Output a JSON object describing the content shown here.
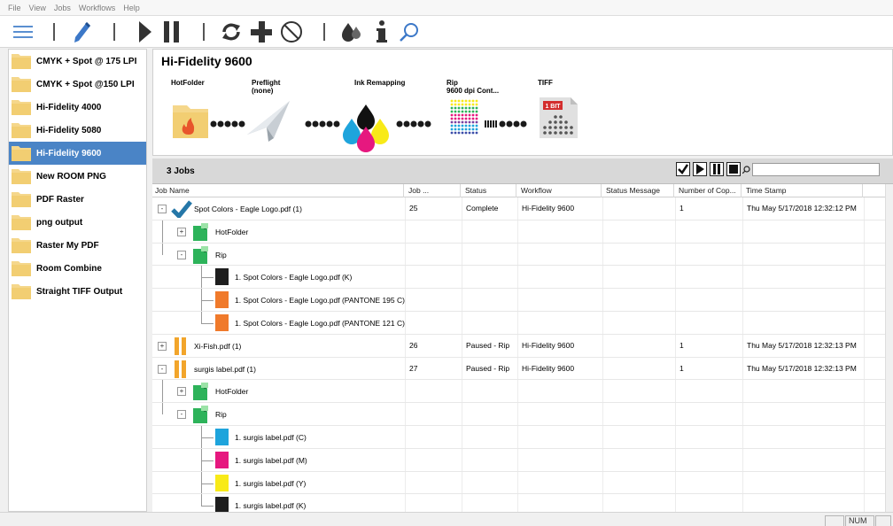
{
  "menu": [
    "File",
    "View",
    "Jobs",
    "Workflows",
    "Help"
  ],
  "workflows": [
    {
      "label": "CMYK + Spot @ 175 LPI",
      "selected": false
    },
    {
      "label": "CMYK + Spot @150 LPI",
      "selected": false
    },
    {
      "label": "Hi-Fidelity 4000",
      "selected": false
    },
    {
      "label": "Hi-Fidelity 5080",
      "selected": false
    },
    {
      "label": "Hi-Fidelity 9600",
      "selected": true
    },
    {
      "label": "New ROOM PNG",
      "selected": false
    },
    {
      "label": "PDF Raster",
      "selected": false
    },
    {
      "label": "png output",
      "selected": false
    },
    {
      "label": "Raster My PDF",
      "selected": false
    },
    {
      "label": "Room Combine",
      "selected": false
    },
    {
      "label": "Straight TIFF Output",
      "selected": false
    }
  ],
  "pipeline": {
    "title": "Hi-Fidelity 9600",
    "stages": [
      {
        "name": "HotFolder",
        "sub": "",
        "icon": "hotfolder-icon"
      },
      {
        "name": "Preflight",
        "sub": "(none)",
        "icon": "paper-plane-icon"
      },
      {
        "name": "Ink Remapping",
        "sub": "",
        "icon": "ink-drops-icon"
      },
      {
        "name": "Rip",
        "sub": "9600 dpi Cont...",
        "icon": "halftone-grid-icon"
      },
      {
        "name": "TIFF",
        "sub": "",
        "icon": "tiff-file-icon"
      }
    ],
    "tiff_badge": "1 BIT"
  },
  "jobs_bar": {
    "count_label": "3 Jobs",
    "search_value": ""
  },
  "columns": [
    "Job Name",
    "Job ...",
    "Status",
    "Workflow",
    "Status Message",
    "Number of Cop...",
    "Time Stamp"
  ],
  "rows": [
    {
      "level": 0,
      "expander": "-",
      "icon": "check",
      "name": "Spot Colors - Eagle Logo.pdf (1)",
      "job": "25",
      "status": "Complete",
      "workflow": "Hi-Fidelity 9600",
      "message": "",
      "copies": "1",
      "time": "Thu May 5/17/2018 12:32:12 PM"
    },
    {
      "level": 1,
      "expander": "+",
      "icon": "step",
      "name": "HotFolder"
    },
    {
      "level": 1,
      "expander": "-",
      "icon": "step",
      "name": "Rip"
    },
    {
      "level": 2,
      "color": "#1e1e1e",
      "name": "1. Spot Colors - Eagle Logo.pdf (K)"
    },
    {
      "level": 2,
      "color": "#f07a2b",
      "name": "1. Spot Colors - Eagle Logo.pdf (PANTONE 195 C)"
    },
    {
      "level": 2,
      "color": "#f07a2b",
      "name": "1. Spot Colors - Eagle Logo.pdf (PANTONE 121 C)"
    },
    {
      "level": 0,
      "expander": "+",
      "icon": "pause",
      "name": "Xi-Fish.pdf (1)",
      "job": "26",
      "status": "Paused - Rip",
      "workflow": "Hi-Fidelity 9600",
      "message": "",
      "copies": "1",
      "time": "Thu May 5/17/2018 12:32:13 PM"
    },
    {
      "level": 0,
      "expander": "-",
      "icon": "pause",
      "name": "surgis label.pdf (1)",
      "job": "27",
      "status": "Paused - Rip",
      "workflow": "Hi-Fidelity 9600",
      "message": "",
      "copies": "1",
      "time": "Thu May 5/17/2018 12:32:13 PM"
    },
    {
      "level": 1,
      "expander": "+",
      "icon": "step",
      "name": "HotFolder"
    },
    {
      "level": 1,
      "expander": "-",
      "icon": "step",
      "name": "Rip"
    },
    {
      "level": 2,
      "color": "#1ea4dc",
      "name": "1. surgis label.pdf (C)"
    },
    {
      "level": 2,
      "color": "#e6187f",
      "name": "1. surgis label.pdf (M)"
    },
    {
      "level": 2,
      "color": "#f8ea18",
      "name": "1. surgis label.pdf (Y)"
    },
    {
      "level": 2,
      "color": "#1e1e1e",
      "name": "1. surgis label.pdf (K)"
    }
  ],
  "statusbar": {
    "num": "NUM"
  },
  "colors": {
    "selection": "#4a84c6",
    "complete_check": "#2577a8",
    "pause": "#f2a52b",
    "step_green": "#2db35a"
  }
}
